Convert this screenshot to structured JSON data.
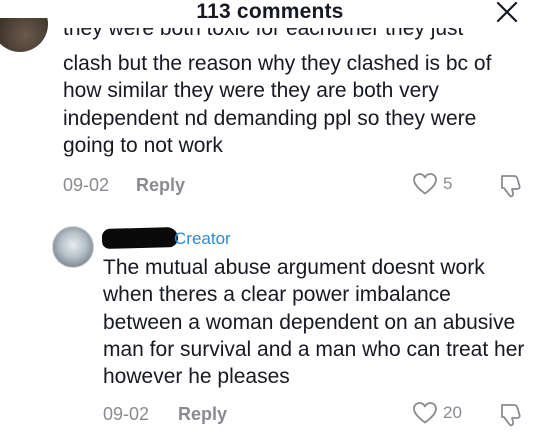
{
  "header": {
    "title": "113 comments",
    "close_icon": "close-icon"
  },
  "comment1": {
    "clipped_line": "they were both toxic for eachother they just",
    "text": "clash but the reason why they clashed is bc of how similar they were they are both very independent nd demanding ppl so they were going to not work",
    "date": "09-02",
    "reply_label": "Reply",
    "likes": "5"
  },
  "comment2": {
    "badge": "Creator",
    "text": "The mutual abuse argument doesnt work when theres a clear power imbalance between a woman dependent on an abusive man for survival and a man who can treat her however he pleases",
    "date": "09-02",
    "reply_label": "Reply",
    "likes": "20"
  },
  "colors": {
    "text": "#161823",
    "muted": "#8a8b91",
    "creator": "#2b8ad6"
  }
}
